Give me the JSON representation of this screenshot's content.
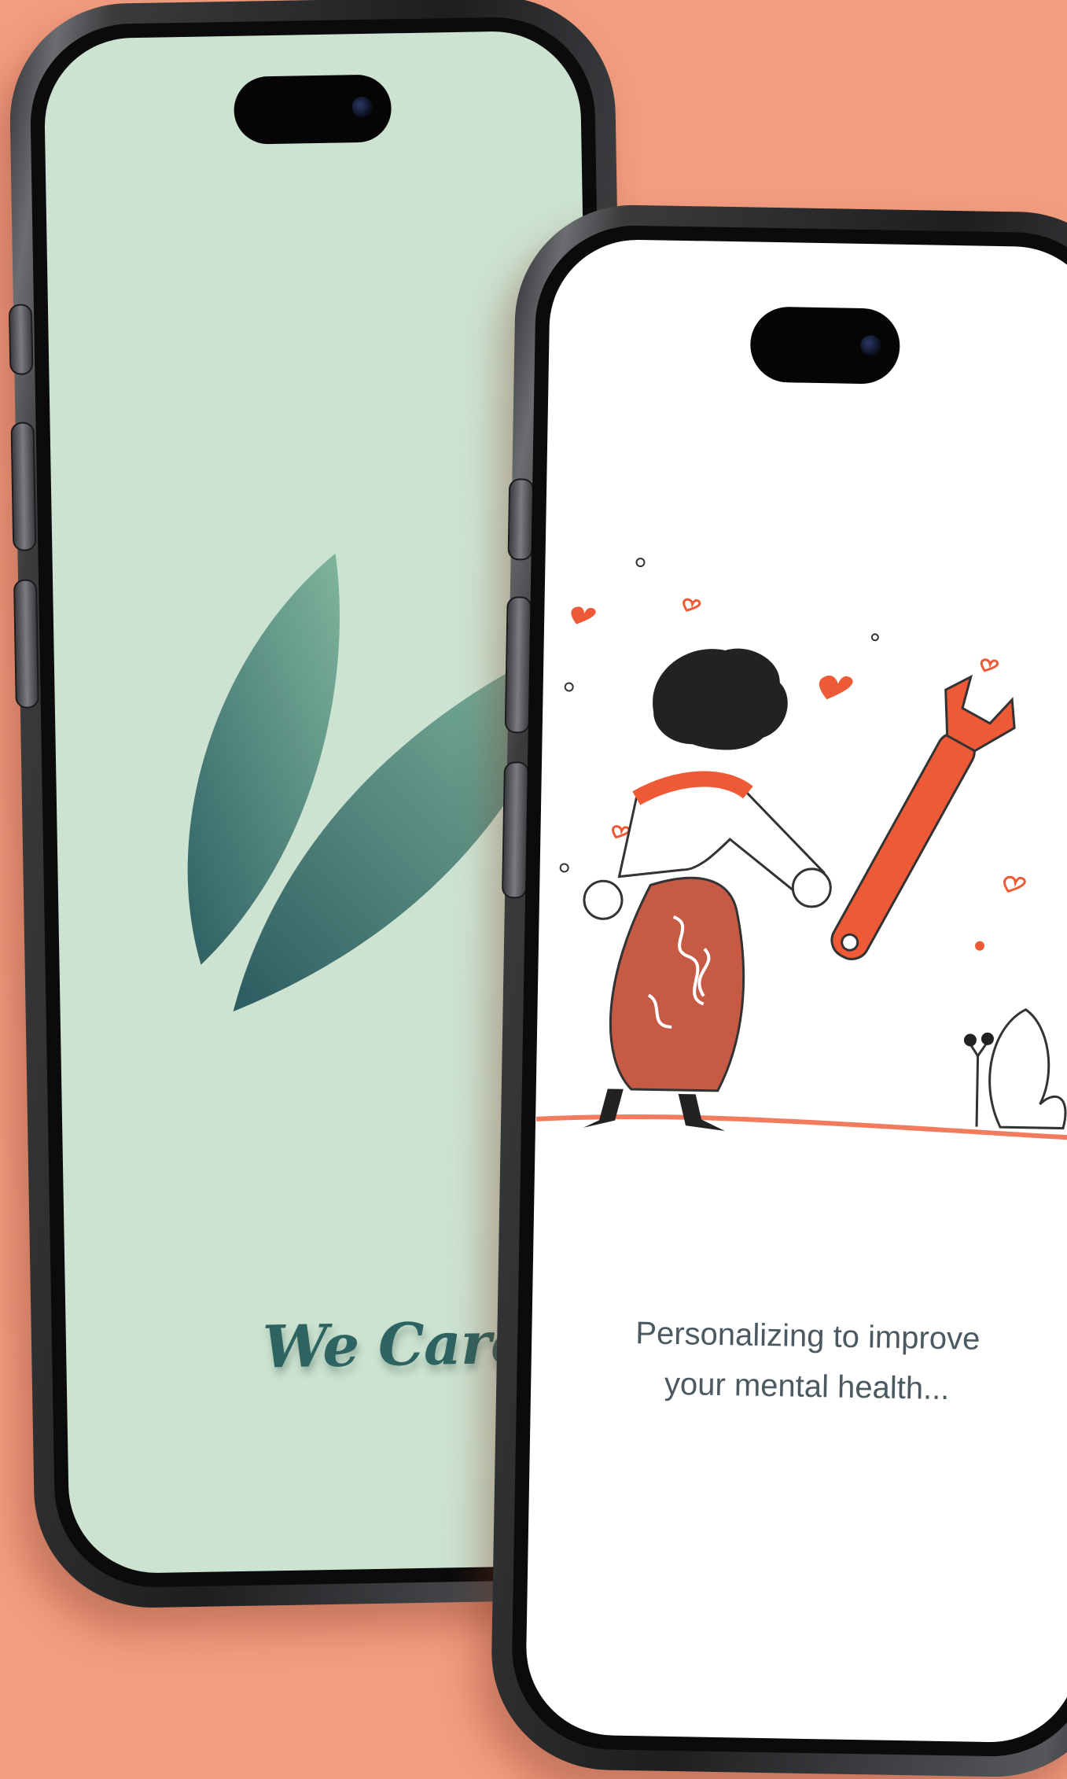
{
  "splash": {
    "brand": "We Care",
    "brand_icon": "leaf-icon",
    "logo_icon": "leaves-logo-icon",
    "background_color": "#CDE3D1",
    "accent_color": "#2D6461"
  },
  "onboarding": {
    "message_line1": "Personalizing to improve",
    "message_line2": "your mental health...",
    "illustration": "person-holding-wrench-illustration",
    "accent_color": "#EF5A36"
  },
  "background_color": "#F29C80"
}
